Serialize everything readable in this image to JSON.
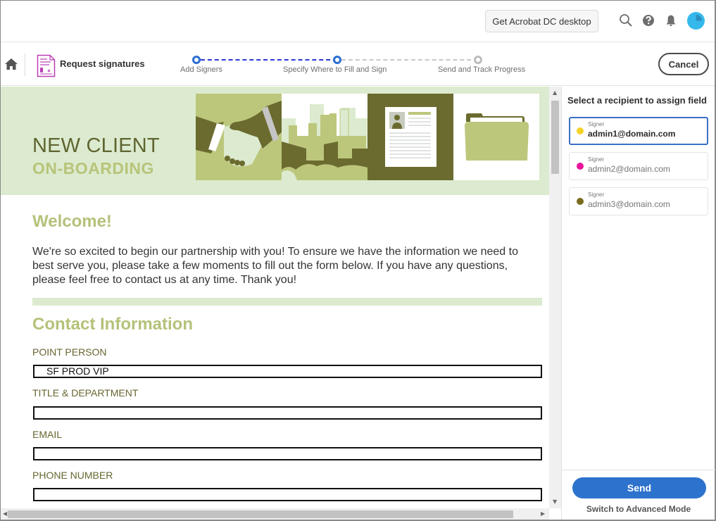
{
  "topbar": {
    "get_desktop_label": "Get Acrobat DC desktop",
    "icons": [
      "search-icon",
      "help-icon",
      "bell-icon",
      "avatar"
    ],
    "avatar_color": "#35b8ec"
  },
  "toolbar": {
    "title": "Request signatures",
    "cancel_label": "Cancel",
    "steps": [
      {
        "label": "Add Signers",
        "state": "complete"
      },
      {
        "label": "Specify Where to Fill and Sign",
        "state": "current"
      },
      {
        "label": "Send and Track Progress",
        "state": "pending"
      }
    ]
  },
  "document": {
    "banner": {
      "title_line1": "NEW CLIENT",
      "title_line2": "ON-BOARDING",
      "tiles": [
        "handshake-illustration",
        "city-skyline-illustration",
        "resume-document-illustration",
        "folder-illustration"
      ]
    },
    "welcome_heading": "Welcome!",
    "intro_text": "We're so excited to begin our partnership with you! To ensure we have the information we need to best serve you, please take a few moments to fill out the form below. If you have any questions, please feel free to contact us at any time. Thank you!",
    "contact_heading": "Contact Information",
    "fields": [
      {
        "label": "POINT PERSON",
        "value": "SF PROD VIP"
      },
      {
        "label": "TITLE & DEPARTMENT",
        "value": ""
      },
      {
        "label": "EMAIL",
        "value": ""
      },
      {
        "label": "PHONE NUMBER",
        "value": ""
      }
    ]
  },
  "panel": {
    "title": "Select a recipient to assign field",
    "recipients": [
      {
        "role": "Signer",
        "email": "admin1@domain.com",
        "color": "#f5d327",
        "selected": true
      },
      {
        "role": "Signer",
        "email": "admin2@domain.com",
        "color": "#e8159a",
        "selected": false
      },
      {
        "role": "Signer",
        "email": "admin3@domain.com",
        "color": "#7a6b1e",
        "selected": false
      }
    ],
    "send_label": "Send",
    "advanced_label": "Switch to Advanced Mode"
  },
  "colors": {
    "accent_blue": "#2d73cd",
    "banner_bg": "#dcebcf",
    "heading_green": "#b4c27a",
    "olive": "#6a6a2e"
  }
}
